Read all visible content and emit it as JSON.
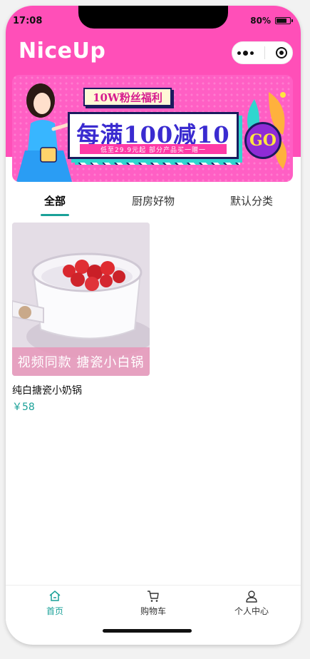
{
  "status_bar": {
    "time": "17:08",
    "battery": "80%",
    "battery_level": 0.8
  },
  "header": {
    "title": "NiceUp"
  },
  "banner": {
    "top_text": "10W粉丝福利",
    "main_text": "每满100减10",
    "sub_text": "低至29.9元起 部分产品买一赠一",
    "go_text": "GO"
  },
  "tabs": [
    {
      "label": "全部",
      "active": true
    },
    {
      "label": "厨房好物",
      "active": false
    },
    {
      "label": "默认分类",
      "active": false
    }
  ],
  "products": [
    {
      "name": "纯白搪瓷小奶锅",
      "price": "￥58",
      "image_caption": "视频同款 搪瓷小白锅"
    }
  ],
  "tabbar": [
    {
      "label": "首页",
      "icon": "home-icon",
      "active": true
    },
    {
      "label": "购物车",
      "icon": "cart-icon",
      "active": false
    },
    {
      "label": "个人中心",
      "icon": "user-icon",
      "active": false
    }
  ],
  "colors": {
    "brand_pink": "#ff4fb8",
    "accent_teal": "#1aa198"
  }
}
